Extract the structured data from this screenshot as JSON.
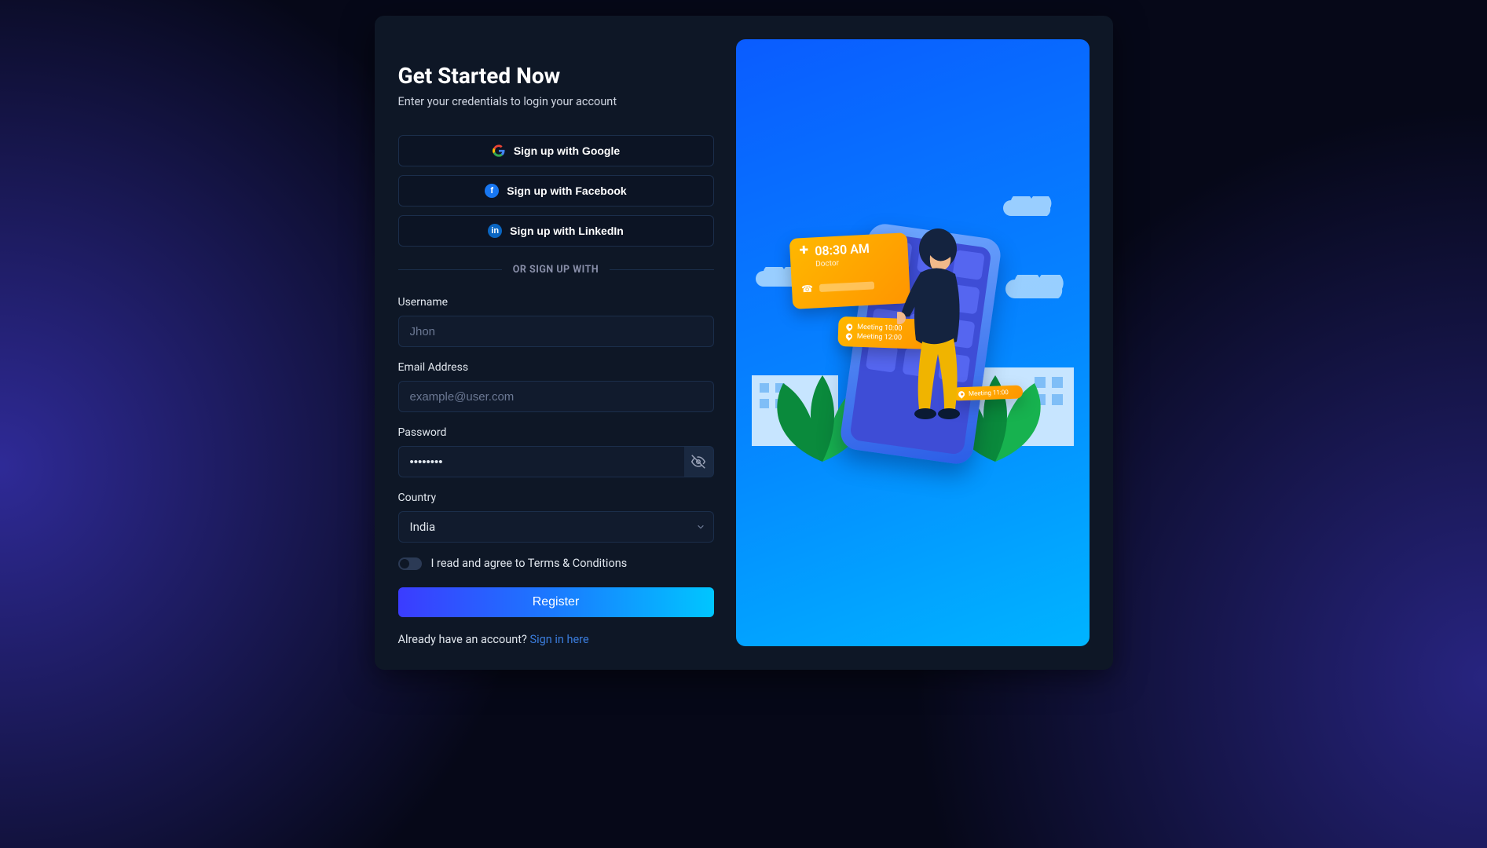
{
  "header": {
    "title": "Get Started Now",
    "subtitle": "Enter your credentials to login your account"
  },
  "social": {
    "google": "Sign up with Google",
    "facebook": "Sign up with Facebook",
    "linkedin": "Sign up with LinkedIn"
  },
  "divider": "OR SIGN UP WITH",
  "fields": {
    "username": {
      "label": "Username",
      "placeholder": "Jhon",
      "value": ""
    },
    "email": {
      "label": "Email Address",
      "placeholder": "example@user.com",
      "value": ""
    },
    "password": {
      "label": "Password",
      "value": "********"
    },
    "country": {
      "label": "Country",
      "value": "India"
    }
  },
  "terms": {
    "text": "I read and agree to Terms & Conditions"
  },
  "actions": {
    "register": "Register",
    "have_account": "Already have an account? ",
    "signin_link": "Sign in here"
  },
  "illustration": {
    "card_time": "08:30 AM",
    "card_role": "Doctor",
    "meeting1": "Meeting 10:00",
    "meeting2": "Meeting 12:00",
    "meeting3": "Meeting 11:00"
  }
}
